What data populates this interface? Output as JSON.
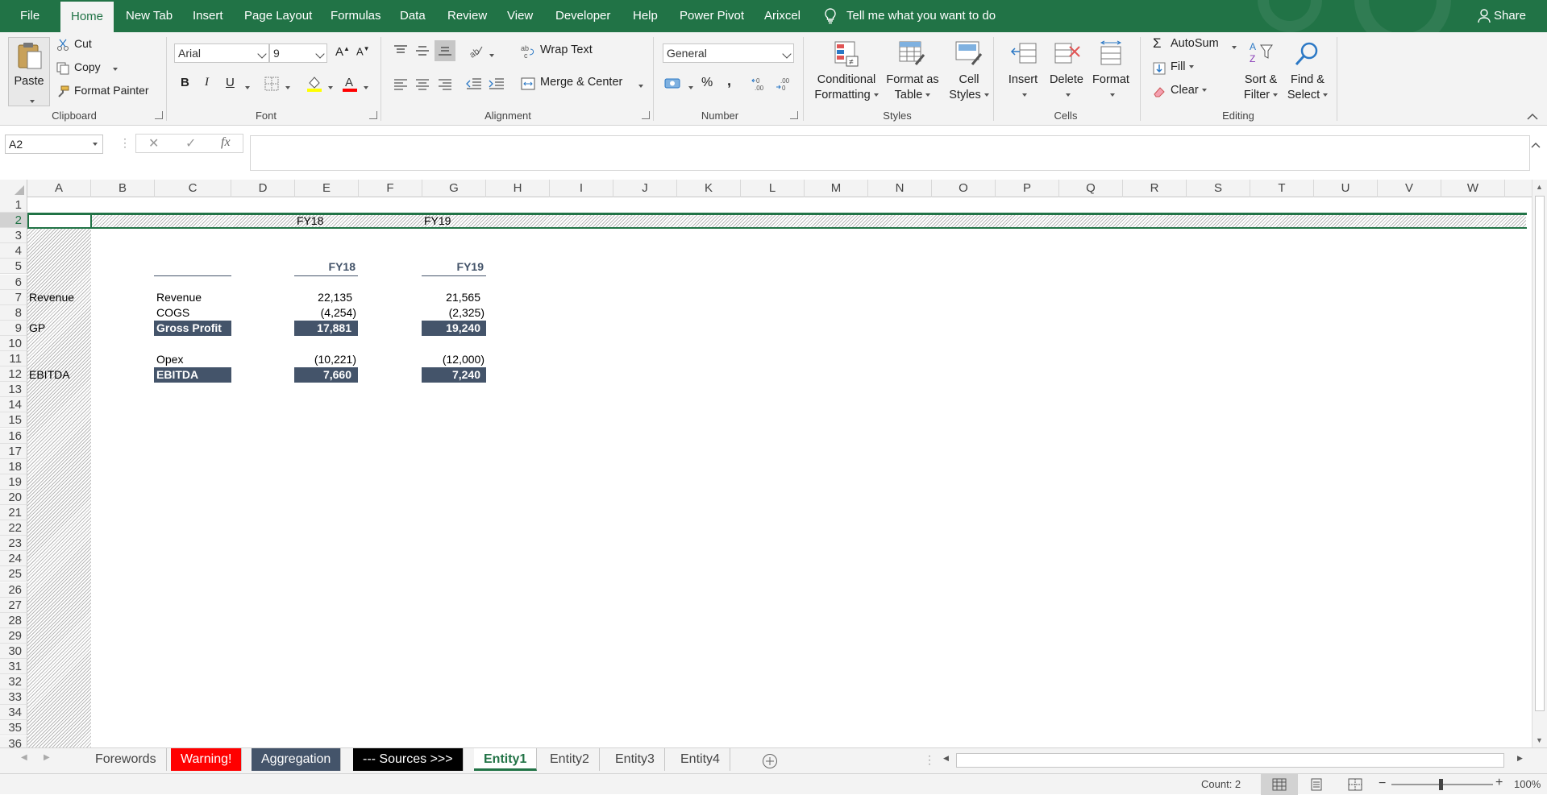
{
  "menu": {
    "tabs": [
      "File",
      "Home",
      "New Tab",
      "Insert",
      "Page Layout",
      "Formulas",
      "Data",
      "Review",
      "View",
      "Developer",
      "Help",
      "Power Pivot",
      "Arixcel"
    ],
    "active": "Home",
    "tell_me": "Tell me what you want to do",
    "share": "Share"
  },
  "ribbon": {
    "clipboard": {
      "paste": "Paste",
      "cut": "Cut",
      "copy": "Copy",
      "format_painter": "Format Painter",
      "label": "Clipboard"
    },
    "font": {
      "name": "Arial",
      "size": "9",
      "bold": "B",
      "italic": "I",
      "underline": "U",
      "label": "Font"
    },
    "alignment": {
      "wrap_text": "Wrap Text",
      "merge_center": "Merge & Center",
      "label": "Alignment"
    },
    "number": {
      "format": "General",
      "percent": "%",
      "comma": ",",
      "label": "Number"
    },
    "styles": {
      "conditional_formatting": [
        "Conditional",
        "Formatting"
      ],
      "format_as_table": [
        "Format as",
        "Table"
      ],
      "cell_styles": [
        "Cell",
        "Styles"
      ],
      "label": "Styles"
    },
    "cells": {
      "insert": "Insert",
      "delete": "Delete",
      "format": "Format",
      "label": "Cells"
    },
    "editing": {
      "autosum": "AutoSum",
      "fill": "Fill",
      "clear": "Clear",
      "sort_filter": [
        "Sort &",
        "Filter"
      ],
      "find_select": [
        "Find &",
        "Select"
      ],
      "label": "Editing"
    }
  },
  "formula_bar": {
    "name_box": "A2",
    "fx": "fx",
    "formula": ""
  },
  "columns": [
    "A",
    "B",
    "C",
    "D",
    "E",
    "F",
    "G",
    "H",
    "I",
    "J",
    "K",
    "L",
    "M",
    "N",
    "O",
    "P",
    "Q",
    "R",
    "S",
    "T",
    "U",
    "V",
    "W"
  ],
  "rows": [
    "1",
    "2",
    "3",
    "4",
    "5",
    "6",
    "7",
    "8",
    "9",
    "10",
    "11",
    "12",
    "13",
    "14",
    "15",
    "16",
    "17",
    "18",
    "19",
    "20",
    "21",
    "22",
    "23",
    "24",
    "25",
    "26",
    "27",
    "28",
    "29",
    "30",
    "31",
    "32",
    "33",
    "34",
    "35",
    "36"
  ],
  "selected_row": "2",
  "sheet": {
    "row2": {
      "e": "FY18",
      "g": "FY19"
    },
    "row4": {
      "e": "FY18",
      "g": "FY19"
    },
    "row6": {
      "a": "Revenue",
      "c": "Revenue",
      "e": "22,135",
      "g": "21,565"
    },
    "row7": {
      "c": "COGS",
      "e": "(4,254)",
      "g": "(2,325)"
    },
    "row8": {
      "a": "GP",
      "c": "Gross Profit",
      "e": "17,881",
      "g": "19,240"
    },
    "row10": {
      "c": "Opex",
      "e": "(10,221)",
      "g": "(12,000)"
    },
    "row11": {
      "a": "EBITDA",
      "c": "EBITDA",
      "e": "7,660",
      "g": "7,240"
    }
  },
  "sheet_tabs": [
    "Forewords",
    "Warning!",
    "Aggregation",
    "--- Sources >>>",
    "Entity1",
    "Entity2",
    "Entity3",
    "Entity4"
  ],
  "active_sheet": "Entity1",
  "status": {
    "count": "Count: 2",
    "zoom": "100%"
  },
  "colors": {
    "excel_green": "#217346",
    "navy": "#44546a",
    "warning_red": "#ff0000"
  }
}
